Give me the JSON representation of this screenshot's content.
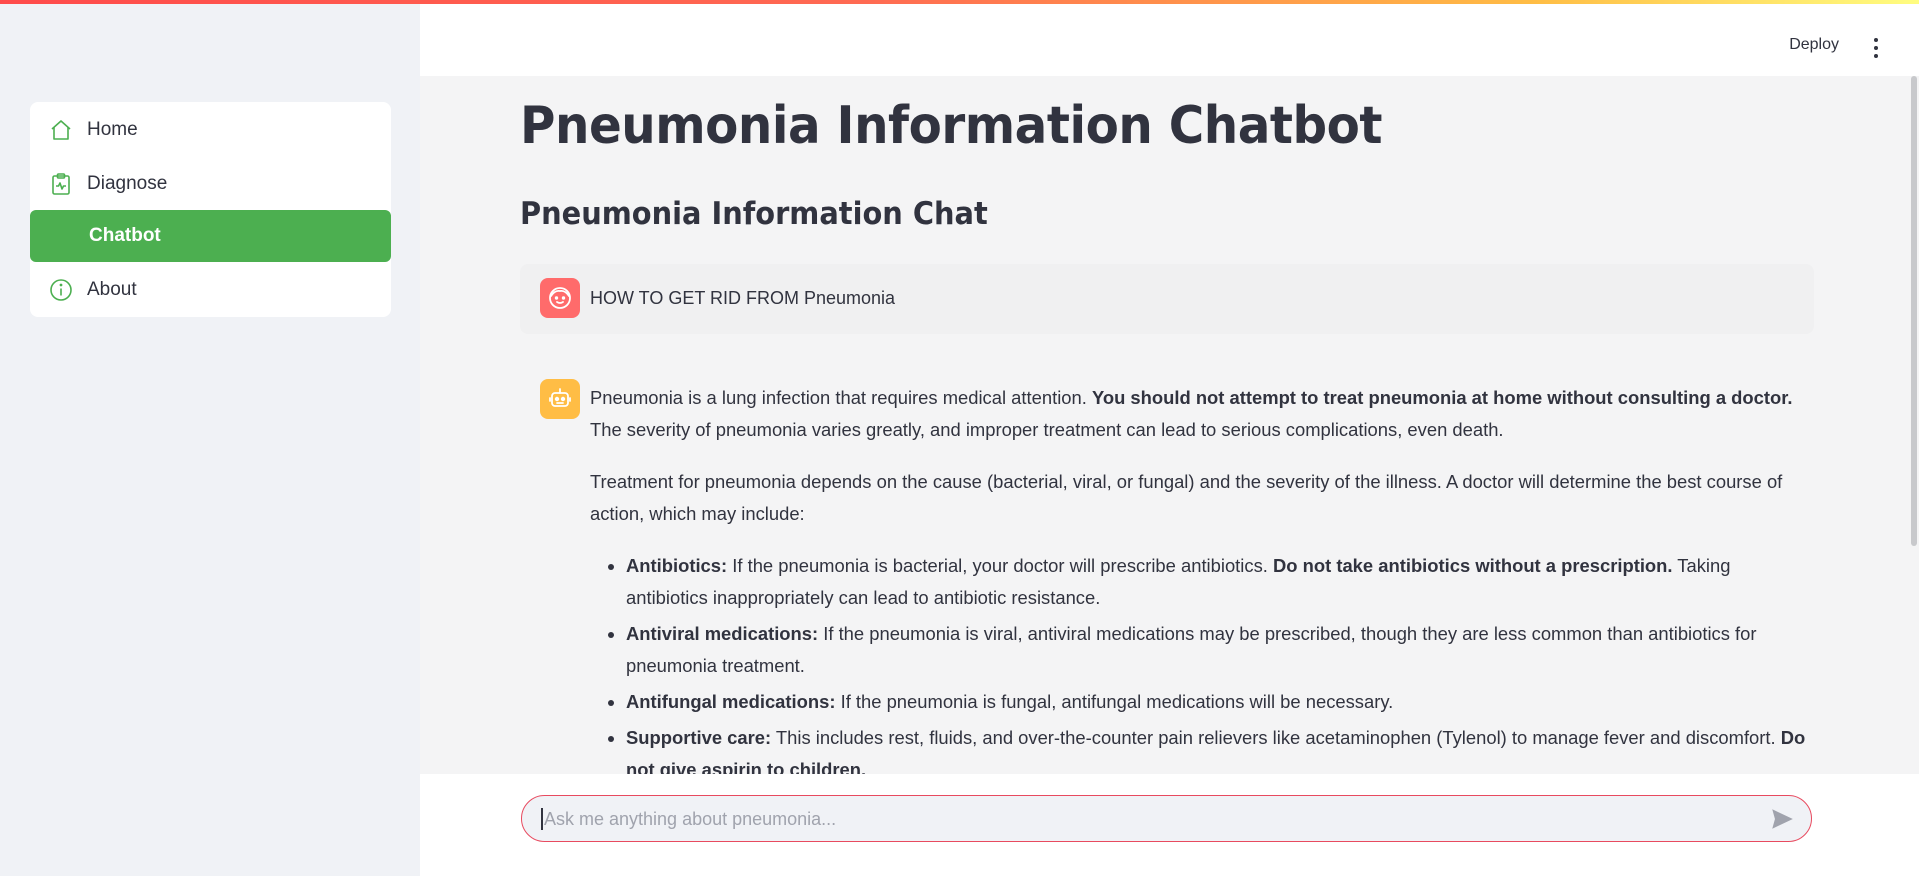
{
  "sidebar": {
    "items": [
      {
        "label": "Home",
        "icon": "home-icon",
        "active": false
      },
      {
        "label": "Diagnose",
        "icon": "clipboard-pulse-icon",
        "active": false
      },
      {
        "label": "Chatbot",
        "icon": "chat-icon",
        "active": true
      },
      {
        "label": "About",
        "icon": "info-icon",
        "active": false
      }
    ],
    "active_color": "#4caf50",
    "icon_color": "#4caf50"
  },
  "header": {
    "deploy_label": "Deploy",
    "menu_icon": "kebab-menu-icon"
  },
  "main": {
    "title": "Pneumonia Information Chatbot",
    "subtitle": "Pneumonia Information Chat"
  },
  "chat": {
    "user_message": "HOW TO GET RID FROM Pneumonia",
    "user_avatar_color": "#ff6b6b",
    "bot_avatar_color": "#ffbd45",
    "bot_response": {
      "p1_text": "Pneumonia is a lung infection that requires medical attention. ",
      "p1_bold": "You should not attempt to treat pneumonia at home without consulting a doctor.",
      "p1_rest": " The severity of pneumonia varies greatly, and improper treatment can lead to serious complications, even death.",
      "p2": "Treatment for pneumonia depends on the cause (bacterial, viral, or fungal) and the severity of the illness. A doctor will determine the best course of action, which may include:",
      "bullets": [
        {
          "bold": "Antibiotics:",
          "text": " If the pneumonia is bacterial, your doctor will prescribe antibiotics. ",
          "bold2": "Do not take antibiotics without a prescription.",
          "text2": " Taking antibiotics inappropriately can lead to antibiotic resistance."
        },
        {
          "bold": "Antiviral medications:",
          "text": " If the pneumonia is viral, antiviral medications may be prescribed, though they are less common than antibiotics for pneumonia treatment.",
          "bold2": "",
          "text2": ""
        },
        {
          "bold": "Antifungal medications:",
          "text": " If the pneumonia is fungal, antifungal medications will be necessary.",
          "bold2": "",
          "text2": ""
        },
        {
          "bold": "Supportive care:",
          "text": " This includes rest, fluids, and over-the-counter pain relievers like acetaminophen (Tylenol) to manage fever and discomfort. ",
          "bold2": "Do not give aspirin to children.",
          "text2": ""
        }
      ]
    },
    "input_placeholder": "Ask me anything about pneumonia...",
    "input_value": "",
    "input_border_color": "#e84a5f",
    "send_icon": "send-icon"
  }
}
